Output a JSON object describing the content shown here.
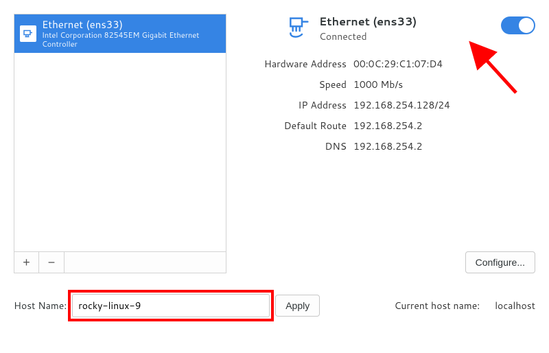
{
  "sidebar": {
    "connection": {
      "title": "Ethernet (ens33)",
      "subtitle": "Intel Corporation 82545EM Gigabit Ethernet Controller"
    },
    "add_label": "+",
    "remove_label": "−"
  },
  "details": {
    "header": {
      "title": "Ethernet (ens33)",
      "status": "Connected"
    },
    "toggle_on": true,
    "rows": {
      "hw_label": "Hardware Address",
      "hw_value": "00:0C:29:C1:07:D4",
      "speed_label": "Speed",
      "speed_value": "1000 Mb/s",
      "ip_label": "IP Address",
      "ip_value": "192.168.254.128/24",
      "route_label": "Default Route",
      "route_value": "192.168.254.2",
      "dns_label": "DNS",
      "dns_value": "192.168.254.2"
    },
    "configure_label": "Configure..."
  },
  "hostname": {
    "label": "Host Name:",
    "value": "rocky-linux-9",
    "apply_label": "Apply",
    "current_label": "Current host name:",
    "current_value": "localhost"
  }
}
